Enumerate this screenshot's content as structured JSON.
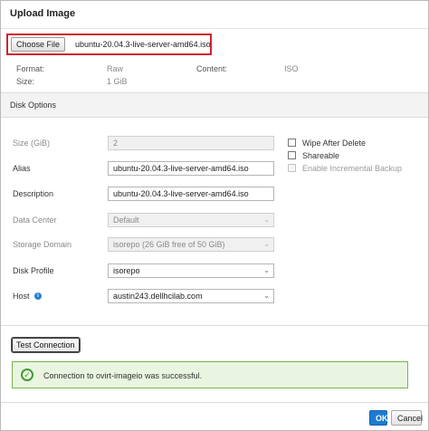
{
  "dialog": {
    "title": "Upload Image",
    "close_glyph": "×"
  },
  "file": {
    "choose_label": "Choose File",
    "file_name": "ubuntu-20.04.3-live-server-amd64.iso"
  },
  "meta": {
    "format_label": "Format:",
    "format_value": "Raw",
    "content_label": "Content:",
    "content_value": "ISO",
    "size_label": "Size:",
    "size_value": "1 GiB"
  },
  "disk_options": {
    "section_title": "Disk Options",
    "size_label": "Size (GiB)",
    "size_value": "2",
    "alias_label": "Alias",
    "alias_value": "ubuntu-20.04.3-live-server-amd64.iso",
    "description_label": "Description",
    "description_value": "ubuntu-20.04.3-live-server-amd64.iso",
    "data_center_label": "Data Center",
    "data_center_value": "Default",
    "storage_domain_label": "Storage Domain",
    "storage_domain_value": "isorepo (26 GiB free of 50 GiB)",
    "disk_profile_label": "Disk Profile",
    "disk_profile_value": "isorepo",
    "host_label": "Host",
    "host_value": "austin243.dellhcilab.com",
    "info_icon": "i",
    "caret": "⌄",
    "wipe_after_delete_label": "Wipe After Delete",
    "shareable_label": "Shareable",
    "enable_incremental_backup_label": "Enable Incremental Backup"
  },
  "test": {
    "button_label": "Test Connection",
    "success_icon": "✓",
    "success_message": "Connection to ovirt-imageio was successful."
  },
  "footer": {
    "ok_label": "OK",
    "cancel_label": "Cancel"
  },
  "colors": {
    "accent": "#1d7ad3",
    "file_highlight": "#d0232f",
    "success": "#3f9c35"
  }
}
